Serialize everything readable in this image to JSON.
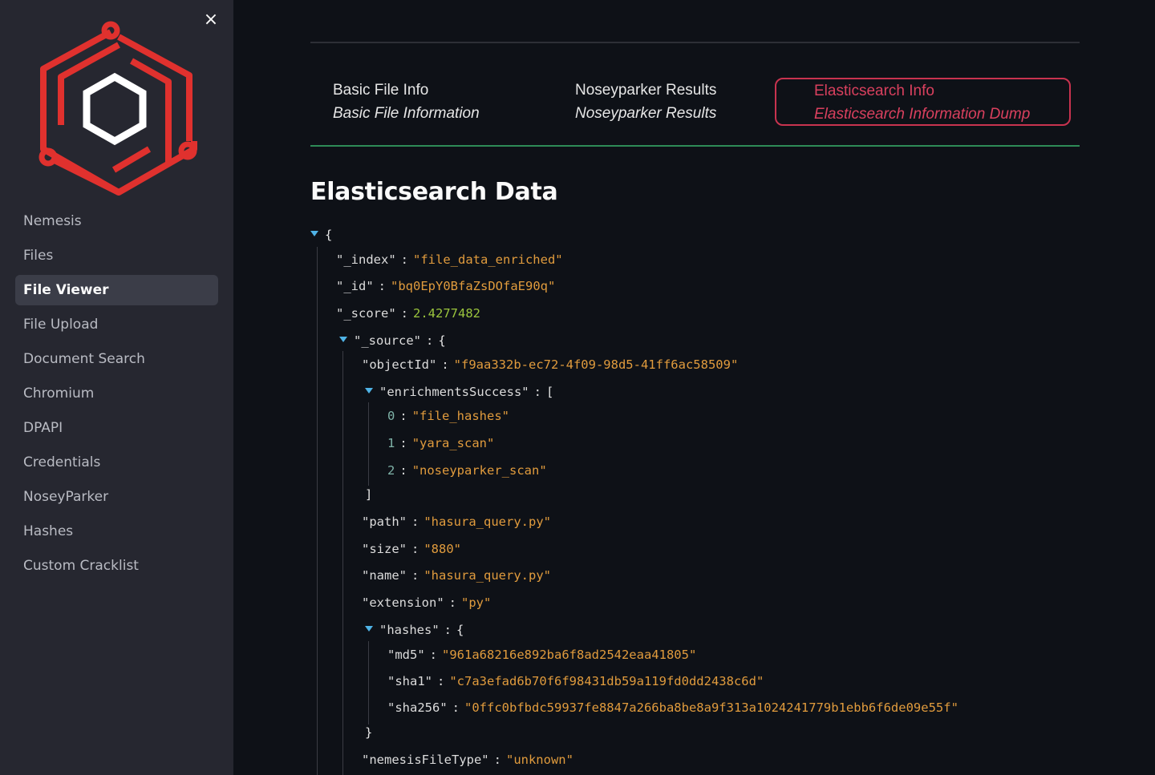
{
  "sidebar": {
    "close_icon": "×",
    "logo_alt": "nemesis-logo",
    "items": [
      {
        "label": "Nemesis",
        "active": false
      },
      {
        "label": "Files",
        "active": false
      },
      {
        "label": "File Viewer",
        "active": true
      },
      {
        "label": "File Upload",
        "active": false
      },
      {
        "label": "Document Search",
        "active": false
      },
      {
        "label": "Chromium",
        "active": false
      },
      {
        "label": "DPAPI",
        "active": false
      },
      {
        "label": "Credentials",
        "active": false
      },
      {
        "label": "NoseyParker",
        "active": false
      },
      {
        "label": "Hashes",
        "active": false
      },
      {
        "label": "Custom Cracklist",
        "active": false
      }
    ]
  },
  "tabs": [
    {
      "label": "Basic File Info",
      "subtitle": "Basic File Information",
      "selected": false
    },
    {
      "label": "Noseyparker Results",
      "subtitle": "Noseyparker Results",
      "selected": false
    },
    {
      "label": "Elasticsearch Info",
      "subtitle": "Elasticsearch Information Dump",
      "selected": true
    }
  ],
  "colors": {
    "accent": "#d9405e",
    "divider": "#2e8b57",
    "string": "#e09b3d",
    "number": "#9bc53d",
    "caret": "#4fb3e6"
  },
  "page": {
    "title": "Elasticsearch Data"
  },
  "json_view": {
    "open_brace": "{",
    "index_key": "\"_index\"",
    "index_val": "\"file_data_enriched\"",
    "id_key": "\"_id\"",
    "id_val": "\"bq0EpY0BfaZsDOfaE90q\"",
    "score_key": "\"_score\"",
    "score_val": "2.4277482",
    "source_key": "\"_source\"",
    "objectId_key": "\"objectId\"",
    "objectId_val": "\"f9aa332b-ec72-4f09-98d5-41ff6ac58509\"",
    "enrich_key": "\"enrichmentsSuccess\"",
    "enrich_items": [
      {
        "index": "0",
        "value": "\"file_hashes\""
      },
      {
        "index": "1",
        "value": "\"yara_scan\""
      },
      {
        "index": "2",
        "value": "\"noseyparker_scan\""
      }
    ],
    "path_key": "\"path\"",
    "path_val": "\"hasura_query.py\"",
    "size_key": "\"size\"",
    "size_val": "\"880\"",
    "name_key": "\"name\"",
    "name_val": "\"hasura_query.py\"",
    "ext_key": "\"extension\"",
    "ext_val": "\"py\"",
    "hashes_key": "\"hashes\"",
    "md5_key": "\"md5\"",
    "md5_val": "\"961a68216e892ba6f8ad2542eaa41805\"",
    "sha1_key": "\"sha1\"",
    "sha1_val": "\"c7a3efad6b70f6f98431db59a119fd0dd2438c6d\"",
    "sha256_key": "\"sha256\"",
    "sha256_val": "\"0ffc0bfbdc59937fe8847a266ba8be8a9f313a1024241779b1ebb6f6de09e55f\"",
    "nft_key": "\"nemesisFileType\"",
    "nft_val": "\"unknown\"",
    "colon": ":",
    "open_bracket": "[",
    "close_bracket": "]",
    "close_brace": "}"
  }
}
